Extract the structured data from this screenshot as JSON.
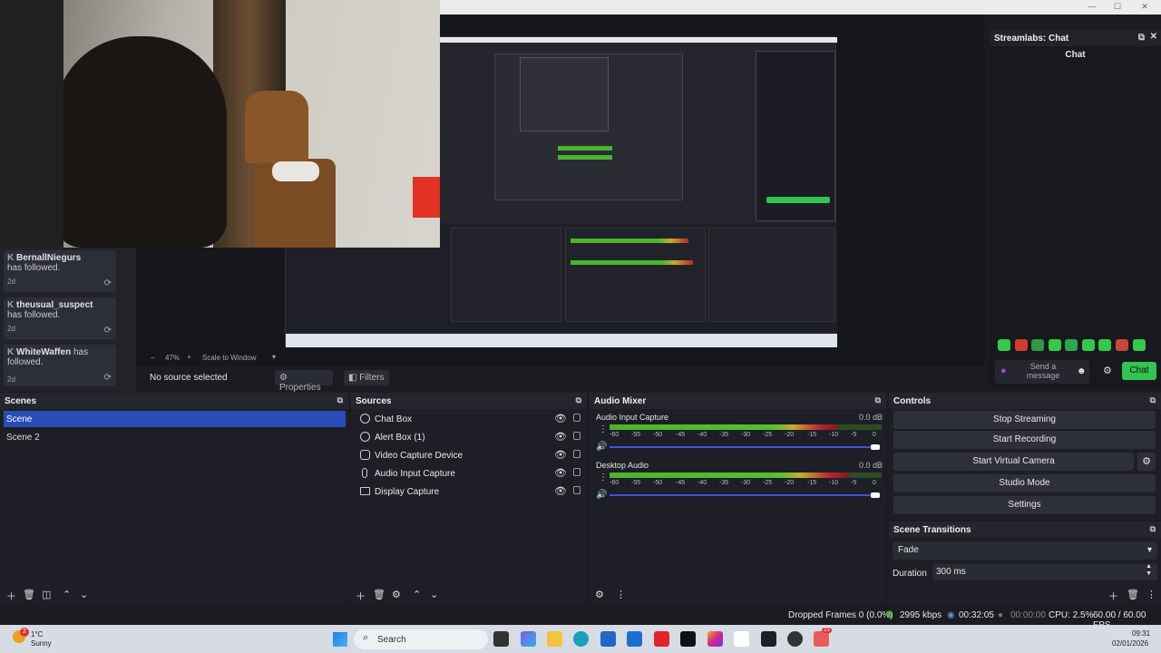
{
  "window": {
    "controls": [
      "—",
      "☐",
      "✕"
    ]
  },
  "activity": {
    "events": [
      {
        "name": "BernallNiegurs",
        "text": "has followed.",
        "age": "2d"
      },
      {
        "name": "theusual_suspect",
        "text": "has followed.",
        "age": "2d"
      },
      {
        "name": "WhiteWaffen",
        "text": "has followed.",
        "age": "2d"
      }
    ]
  },
  "preview": {
    "zoom": "47%",
    "scale_mode": "Scale to Window",
    "no_source": "No source selected",
    "properties": "Properties",
    "filters": "Filters"
  },
  "chat_dock": {
    "title": "Streamlabs: Chat",
    "heading": "Chat",
    "send_placeholder": "Send a message",
    "chat_button": "Chat"
  },
  "scenes": {
    "title": "Scenes",
    "items": [
      "Scene",
      "Scene 2"
    ],
    "selected": 0
  },
  "sources": {
    "title": "Sources",
    "items": [
      {
        "name": "Chat Box",
        "icon": "browser-icon"
      },
      {
        "name": "Alert Box (1)",
        "icon": "browser-icon"
      },
      {
        "name": "Video Capture Device",
        "icon": "camera-icon"
      },
      {
        "name": "Audio Input Capture",
        "icon": "microphone-icon"
      },
      {
        "name": "Display Capture",
        "icon": "monitor-icon"
      }
    ]
  },
  "mixer": {
    "title": "Audio Mixer",
    "channels": [
      {
        "name": "Audio Input Capture",
        "db": "0.0 dB",
        "level": 0.84
      },
      {
        "name": "Desktop Audio",
        "db": "0.0 dB",
        "level": 0.88
      }
    ],
    "ticks": [
      "-60",
      "-55",
      "-50",
      "-45",
      "-40",
      "-35",
      "-30",
      "-25",
      "-20",
      "-15",
      "-10",
      "-5",
      "0"
    ]
  },
  "controls": {
    "title": "Controls",
    "buttons": [
      "Stop Streaming",
      "Start Recording",
      "Start Virtual Camera",
      "Studio Mode",
      "Settings"
    ]
  },
  "transitions": {
    "title": "Scene Transitions",
    "selected": "Fade",
    "duration_label": "Duration",
    "duration": "300 ms"
  },
  "status": {
    "dropped": "Dropped Frames 0 (0.0%)",
    "bitrate": "2995 kbps",
    "stream_time": "00:32:05",
    "rec_time": "00:00:00",
    "cpu": "CPU: 2.5%",
    "fps": "60.00 / 60.00 FPS"
  },
  "taskbar": {
    "weather_temp": "1°C",
    "weather_desc": "Sunny",
    "weather_badge": "2",
    "search": "Search",
    "time": "09:31",
    "date": "02/01/2026",
    "app_badge": "23"
  },
  "colors": {
    "accent": "#284cb8",
    "chat_green": "#31c453",
    "meter_green": "#4ab52d",
    "meter_yellow": "#c8ac2b",
    "meter_red": "#b9262c"
  }
}
